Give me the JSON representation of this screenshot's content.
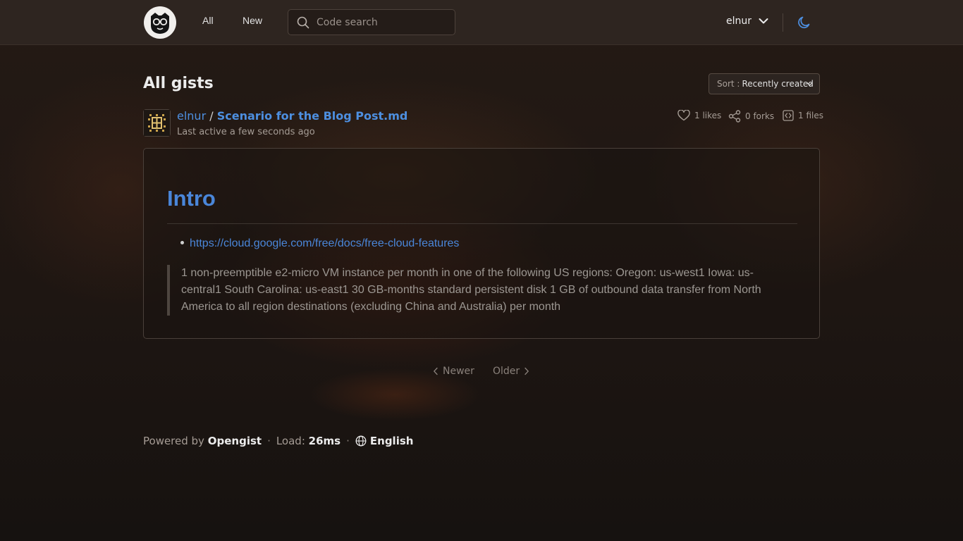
{
  "nav": {
    "all_label": "All",
    "new_label": "New",
    "search_placeholder": "Code search",
    "username": "elnur"
  },
  "page": {
    "title": "All gists",
    "sort_prefix": "Sort :",
    "sort_value": "Recently created"
  },
  "gist": {
    "owner": "elnur",
    "separator": "/",
    "title": "Scenario for the Blog Post.md",
    "last_active": "Last active a few seconds ago",
    "likes": "1 likes",
    "forks": "0 forks",
    "files": "1 files",
    "content": {
      "heading": "Intro",
      "link": "https://cloud.google.com/free/docs/free-cloud-features",
      "quote": "1 non-preemptible e2-micro VM instance per month in one of the following US regions: Oregon: us-west1 Iowa: us-central1 South Carolina: us-east1 30 GB-months standard persistent disk 1 GB of outbound data transfer from North America to all region destinations (excluding China and Australia) per month"
    }
  },
  "pagination": {
    "newer": "Newer",
    "older": "Older"
  },
  "footer": {
    "powered_by": "Powered by",
    "app_name": "Opengist",
    "load_label": "Load:",
    "load_value": "26ms",
    "language": "English"
  },
  "colors": {
    "accent": "#4d8fe0",
    "topbar": "#2e2520"
  }
}
